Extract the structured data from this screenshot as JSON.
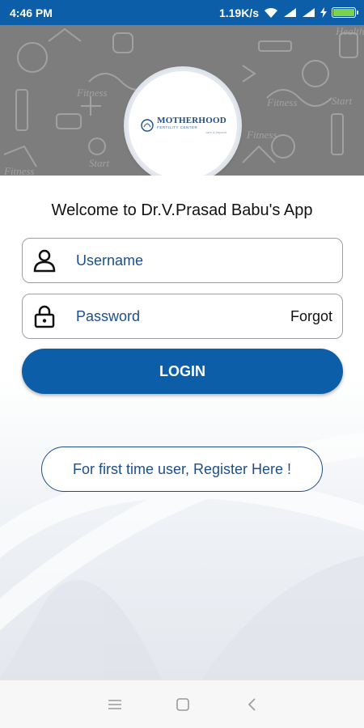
{
  "status_bar": {
    "time": "4:46 PM",
    "network_speed": "1.19K/s",
    "icons": [
      "wifi-icon",
      "signal-icon",
      "signal-icon",
      "charging-icon",
      "battery-icon"
    ],
    "battery_color": "#7bd34b"
  },
  "header": {
    "logo": {
      "title": "MOTHERHOOD",
      "subtitle": "FERTILITY CENTER",
      "tagline": "care & beyond"
    }
  },
  "login": {
    "welcome": "Welcome to Dr.V.Prasad Babu's App",
    "username_placeholder": "Username",
    "password_placeholder": "Password",
    "forgot_label": "Forgot",
    "login_label": "LOGIN",
    "register_label": "For first time user, Register Here !"
  },
  "nav_bar": {
    "icons": [
      "menu-icon",
      "home-icon",
      "back-icon"
    ]
  },
  "colors": {
    "primary": "#0d5ea8",
    "text_blue": "#1c4f8a",
    "header_gray": "#7d7d7d"
  }
}
